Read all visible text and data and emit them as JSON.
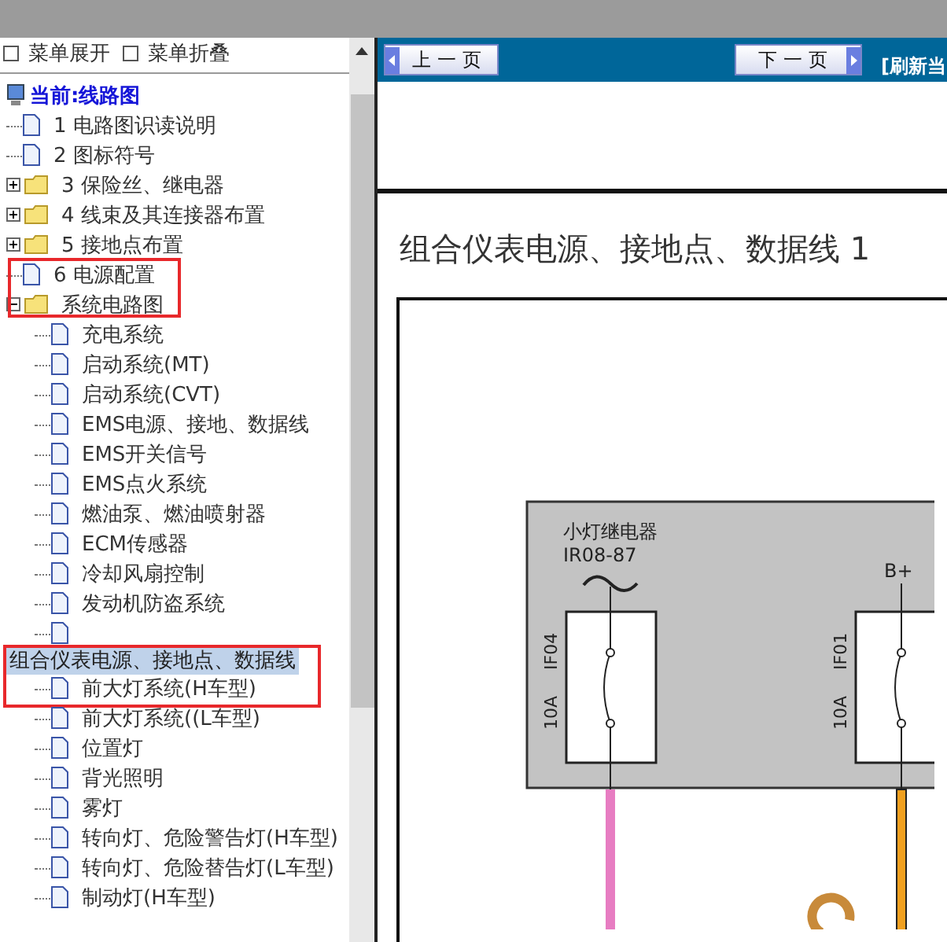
{
  "sidebar": {
    "toolbar": [
      {
        "label": "菜单展开"
      },
      {
        "label": "菜单折叠"
      }
    ],
    "tree": {
      "label": "当前:线路图",
      "children": [
        {
          "kind": "doc",
          "label": "1 电路图识读说明"
        },
        {
          "kind": "doc",
          "label": "2 图标符号"
        },
        {
          "kind": "folder",
          "label": "3 保险丝、继电器",
          "expanded": false
        },
        {
          "kind": "folder",
          "label": "4 线束及其连接器布置",
          "expanded": false
        },
        {
          "kind": "folder",
          "label": "5 接地点布置",
          "expanded": false
        },
        {
          "kind": "doc",
          "label": "6 电源配置"
        },
        {
          "kind": "folder",
          "label": "系统电路图",
          "expanded": true,
          "marked": true,
          "children": [
            {
              "kind": "doc",
              "label": "充电系统"
            },
            {
              "kind": "doc",
              "label": "启动系统(MT)"
            },
            {
              "kind": "doc",
              "label": "启动系统(CVT)"
            },
            {
              "kind": "doc",
              "label": "EMS电源、接地、数据线"
            },
            {
              "kind": "doc",
              "label": "EMS开关信号"
            },
            {
              "kind": "doc",
              "label": "EMS点火系统"
            },
            {
              "kind": "doc",
              "label": "燃油泵、燃油喷射器"
            },
            {
              "kind": "doc",
              "label": "ECM传感器"
            },
            {
              "kind": "doc",
              "label": "冷却风扇控制"
            },
            {
              "kind": "doc",
              "label": "发动机防盗系统"
            },
            {
              "kind": "blank"
            },
            {
              "kind": "drag_ghost",
              "label": "组合仪表电源、接地点、数据线",
              "marked": true
            },
            {
              "kind": "doc",
              "label": "前大灯系统(H车型)"
            },
            {
              "kind": "doc",
              "label": "前大灯系统((L车型)"
            },
            {
              "kind": "doc",
              "label": "位置灯"
            },
            {
              "kind": "doc",
              "label": "背光照明"
            },
            {
              "kind": "doc",
              "label": "雾灯"
            },
            {
              "kind": "doc",
              "label": "转向灯、危险警告灯(H车型)"
            },
            {
              "kind": "doc",
              "label": "转向灯、危险替告灯(L车型)"
            },
            {
              "kind": "doc",
              "label": "制动灯(H车型)"
            }
          ]
        }
      ]
    }
  },
  "content": {
    "toolbar": {
      "buttons": [
        {
          "kind": "prev",
          "label": "上一页"
        },
        {
          "kind": "next",
          "label": "下一页"
        }
      ],
      "link": "[刷新当"
    },
    "title": "组合仪表电源、接地点、数据线 1",
    "diagram": {
      "relay_name": "小灯继电器",
      "relay_code": "IR08-87",
      "supply": "B+",
      "fuses": [
        {
          "id": "IF04",
          "rating": "10A"
        },
        {
          "id": "IF01",
          "rating": "10A"
        }
      ]
    }
  }
}
